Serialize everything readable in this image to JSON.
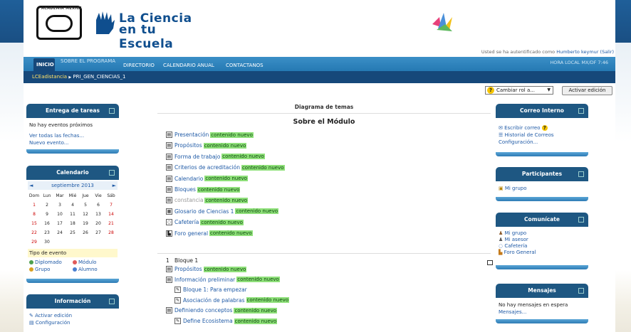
{
  "header": {
    "seal_text": "ACADEMIA MEXICANA DE CIENCIAS",
    "brand_line1": "La Ciencia",
    "brand_line2": "en tu Escuela",
    "auth_prefix": "Usted se ha autentificado como",
    "auth_user": "Humberto keymur",
    "auth_logout": "(Salir)"
  },
  "nav": {
    "items": [
      "INICIO",
      "SOBRE EL PROGRAMA",
      "DIRECTORIO",
      "CALENDARIO ANUAL",
      "CONTACTANOS"
    ],
    "hora": "HORA LOCAL MX/DF 7:46"
  },
  "breadcrumb": {
    "home": "LCEadistancia",
    "sep": "▶",
    "current": "PRI_GEN_CIENCIAS_1"
  },
  "controls": {
    "role_select": "Cambiar rol a...",
    "edit_button": "Activar edición"
  },
  "left": {
    "tareas": {
      "title": "Entrega de tareas",
      "empty": "No hay eventos próximos",
      "link1": "Ver todas las fechas...",
      "link2": "Nuevo evento..."
    },
    "calendario": {
      "title": "Calendario",
      "month": "septiembre 2013",
      "prev": "◄",
      "next": "►",
      "weekdays": [
        "Dom",
        "Lun",
        "Mar",
        "Mié",
        "Jue",
        "Vie",
        "Sáb"
      ],
      "days": [
        [
          "1",
          "2",
          "3",
          "4",
          "5",
          "6",
          "7"
        ],
        [
          "8",
          "9",
          "10",
          "11",
          "12",
          "13",
          "14"
        ],
        [
          "15",
          "16",
          "17",
          "18",
          "19",
          "20",
          "21"
        ],
        [
          "22",
          "23",
          "24",
          "25",
          "26",
          "27",
          "28"
        ],
        [
          "29",
          "30",
          "",
          "",
          "",
          "",
          ""
        ]
      ],
      "event_type_label": "Tipo de evento",
      "event_types": [
        "Diplomado",
        "Módulo",
        "Grupo",
        "Alumno"
      ]
    },
    "informacion": {
      "title": "Información",
      "items": [
        "Activar edición",
        "Configuración"
      ]
    }
  },
  "center": {
    "diagram_title": "Diagrama de temas",
    "section_title": "Sobre el Módulo",
    "new_label": "contenido nuevo",
    "activities": [
      "Presentación",
      "Propósitos",
      "Forma de trabajo",
      "Criterios de acreditación",
      "Calendario",
      "Bloques",
      "constancia",
      "Glosario de Ciencias 1",
      "Cafetería",
      "Foro general"
    ],
    "section2_num": "1",
    "section2_title": "Bloque 1",
    "section2_items": [
      "Propósitos",
      "Información preliminar",
      "Bloque 1: Para empezar",
      "Asociación de palabras",
      "Definiendo conceptos",
      "Define Ecosistema"
    ]
  },
  "right": {
    "correo": {
      "title": "Correo Interno",
      "items": [
        "Escribir correo",
        "Historial de Correos",
        "Configuración..."
      ]
    },
    "participantes": {
      "title": "Participantes",
      "item": "Mi grupo"
    },
    "comunicate": {
      "title": "Comunícate",
      "items": [
        "Mi grupo",
        "Mi asesor",
        "Cafetería",
        "Foro General"
      ]
    },
    "mensajes": {
      "title": "Mensajes",
      "empty": "No hay mensajes en espera",
      "link": "Mensajes..."
    }
  }
}
